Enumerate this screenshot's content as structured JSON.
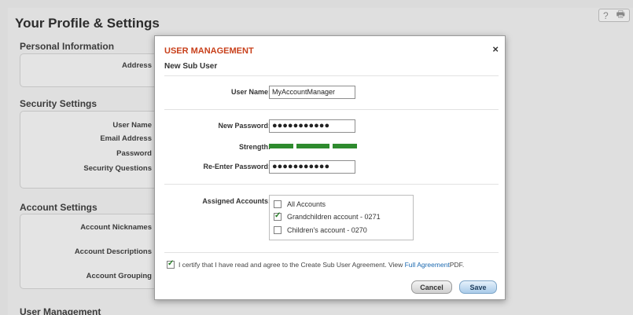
{
  "page": {
    "title": "Your Profile & Settings",
    "header_icons": [
      "help-icon",
      "print-icon"
    ],
    "help_glyph": "?",
    "print_glyph": "🖶"
  },
  "sections": {
    "personal": {
      "title": "Personal Information",
      "fields": [
        "Address"
      ]
    },
    "security": {
      "title": "Security Settings",
      "fields": [
        "User Name",
        "Email Address",
        "Password",
        "Security Questions"
      ]
    },
    "account": {
      "title": "Account Settings",
      "fields": [
        "Account Nicknames",
        "Account Descriptions",
        "Account Grouping"
      ]
    },
    "user_mgmt": {
      "title": "User Management"
    }
  },
  "modal": {
    "title": "USER MANAGEMENT",
    "close_glyph": "×",
    "subtitle": "New Sub User",
    "username_label": "User Name:",
    "username_value": "MyAccountManager",
    "new_password_label": "New Password:",
    "new_password_value": "●●●●●●●●●●●",
    "strength_label": "Strength:",
    "strength_level": "3 of 3",
    "reenter_label": "Re-Enter Password:",
    "reenter_value": "●●●●●●●●●●●",
    "assigned_label": "Assigned Accounts:",
    "accounts": [
      {
        "label": "All Accounts",
        "checked": false
      },
      {
        "label": "Grandchildren account - 0271",
        "checked": true
      },
      {
        "label": "Children's account - 0270",
        "checked": false
      }
    ],
    "certify_text": "I certify that I have read and agree to the Create Sub User Agreement. View ",
    "certify_link": "Full Agreement",
    "certify_suffix": " PDF.",
    "certify_checked": true,
    "cancel_label": "Cancel",
    "save_label": "Save",
    "colors": {
      "title": "#c8401b",
      "strength": "#2e8b2e",
      "link": "#1d6ab0"
    }
  }
}
